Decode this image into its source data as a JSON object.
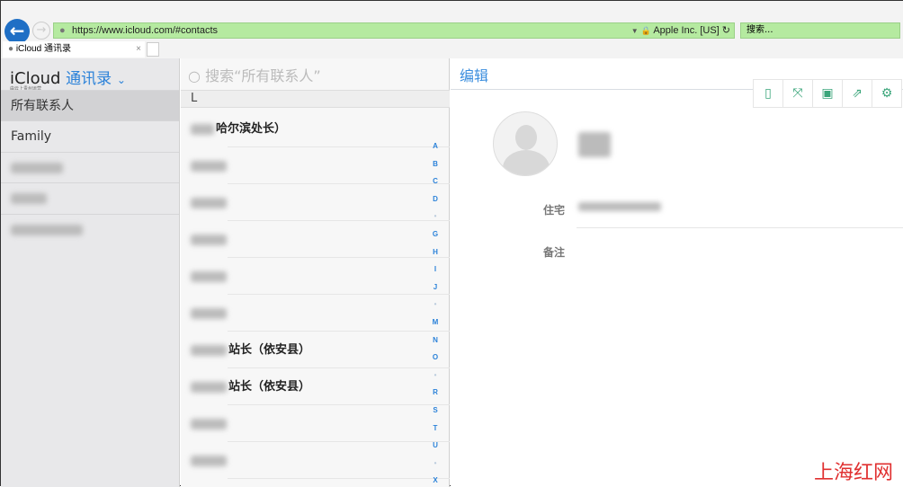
{
  "browser": {
    "url": "https://www.icloud.com/#contacts",
    "site_identity": "Apple Inc. [US]",
    "search_placeholder": "搜索...",
    "tab_title": "iCloud 通讯录",
    "tab_close": "×",
    "back": "←",
    "forward": "→",
    "reload": "↻",
    "lock": "🔒"
  },
  "sidebar": {
    "brand": "iCloud",
    "app": "通讯录",
    "chevron": "⌄",
    "brand_sub": "由云上贵州运营",
    "items": [
      {
        "label": "所有联系人",
        "selected": true
      },
      {
        "label": "Family"
      },
      {
        "label": "",
        "blurred": true
      },
      {
        "label": "",
        "blurred": true
      },
      {
        "label": "",
        "blurred": true
      }
    ]
  },
  "list": {
    "search_placeholder": "搜索“所有联系人”",
    "section": "L",
    "rows": [
      {
        "visible": "哈尔滨处长）"
      },
      {
        "visible": ""
      },
      {
        "visible": ""
      },
      {
        "visible": ""
      },
      {
        "visible": ""
      },
      {
        "visible": ""
      },
      {
        "visible": "站长（依安县）"
      },
      {
        "visible": "站长（依安县）"
      },
      {
        "visible": ""
      },
      {
        "visible": ""
      }
    ],
    "index": [
      "A",
      "B",
      "C",
      "D",
      "•",
      "G",
      "H",
      "I",
      "J",
      "•",
      "M",
      "N",
      "O",
      "•",
      "R",
      "S",
      "T",
      "U",
      "•",
      "X"
    ]
  },
  "detail": {
    "edit": "编辑",
    "field_home": "住宅",
    "field_notes": "备注",
    "tools": [
      "tablet-icon",
      "fullscreen-icon",
      "save-icon",
      "share-icon",
      "gear-icon"
    ]
  },
  "watermark": "上海红网"
}
